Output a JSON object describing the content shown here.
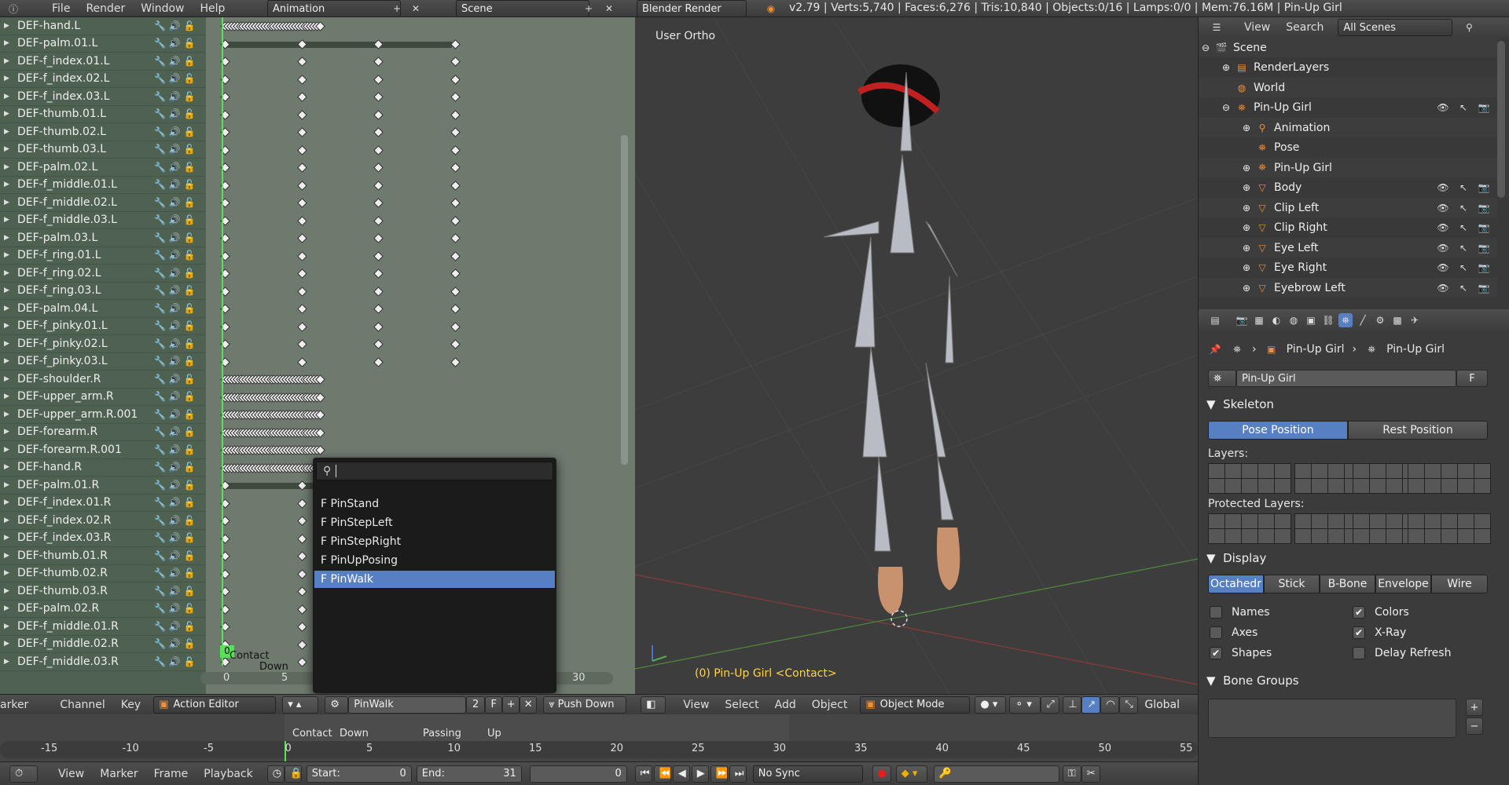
{
  "topbar": {
    "menus": [
      "File",
      "Render",
      "Window",
      "Help"
    ],
    "screen_layout": "Animation",
    "scene": "Scene",
    "engine": "Blender Render",
    "stats": "v2.79 | Verts:5,740 | Faces:6,276 | Tris:10,840 | Objects:0/16 | Lamps:0/0 | Mem:76.16M | Pin-Up Girl"
  },
  "dopesheet": {
    "channels": [
      "DEF-hand.L",
      "DEF-palm.01.L",
      "DEF-f_index.01.L",
      "DEF-f_index.02.L",
      "DEF-f_index.03.L",
      "DEF-thumb.01.L",
      "DEF-thumb.02.L",
      "DEF-thumb.03.L",
      "DEF-palm.02.L",
      "DEF-f_middle.01.L",
      "DEF-f_middle.02.L",
      "DEF-f_middle.03.L",
      "DEF-palm.03.L",
      "DEF-f_ring.01.L",
      "DEF-f_ring.02.L",
      "DEF-f_ring.03.L",
      "DEF-palm.04.L",
      "DEF-f_pinky.01.L",
      "DEF-f_pinky.02.L",
      "DEF-f_pinky.03.L",
      "DEF-shoulder.R",
      "DEF-upper_arm.R",
      "DEF-upper_arm.R.001",
      "DEF-forearm.R",
      "DEF-forearm.R.001",
      "DEF-hand.R",
      "DEF-palm.01.R",
      "DEF-f_index.01.R",
      "DEF-f_index.02.R",
      "DEF-f_index.03.R",
      "DEF-thumb.01.R",
      "DEF-thumb.02.R",
      "DEF-thumb.03.R",
      "DEF-palm.02.R",
      "DEF-f_middle.01.R",
      "DEF-f_middle.02.R",
      "DEF-f_middle.03.R"
    ],
    "channel_icons": "🔧 🔊 🔓",
    "markers": [
      "Contact",
      "Down",
      "Passing",
      "Up"
    ],
    "current_frame_badge": "0",
    "ruler": [
      "0",
      "5",
      "10",
      "15",
      "20",
      "25",
      "30"
    ]
  },
  "action_popup": {
    "search_icon": "search-icon",
    "items": [
      "F PinStand",
      "F PinStepLeft",
      "F PinStepRight",
      "F PinUpPosing",
      "F PinWalk"
    ],
    "selected": "F PinWalk"
  },
  "view3d": {
    "label": "User Ortho",
    "status": "(0) Pin-Up Girl <Contact>",
    "menus": [
      "View",
      "Select",
      "Add",
      "Object"
    ],
    "mode": "Object Mode",
    "orientation": "Global"
  },
  "dopesheet_header": {
    "menus": [
      "arker",
      "Channel",
      "Key"
    ],
    "editor": "Action Editor",
    "action": "PinWalk",
    "users": "2",
    "fake": "F",
    "push_down": "Push Down"
  },
  "timeline": {
    "ruler": [
      "-15",
      "-10",
      "-5",
      "0",
      "5",
      "10",
      "15",
      "20",
      "25",
      "30",
      "35",
      "40",
      "45",
      "50",
      "55"
    ],
    "markers": [
      "Contact",
      "Down",
      "Passing",
      "Up"
    ]
  },
  "timeline_header": {
    "menus": [
      "View",
      "Marker",
      "Frame",
      "Playback"
    ],
    "start_label": "Start:",
    "start": "0",
    "end_label": "End:",
    "end": "31",
    "current": "0",
    "sync": "No Sync"
  },
  "outliner": {
    "menus": [
      "View",
      "Search"
    ],
    "filter": "All Scenes",
    "items": [
      "Scene",
      "RenderLayers",
      "World",
      "Pin-Up Girl",
      "Animation",
      "Pose",
      "Pin-Up Girl",
      "Body",
      "Clip Left",
      "Clip Right",
      "Eye Left",
      "Eye Right",
      "Eyebrow Left"
    ]
  },
  "properties": {
    "breadcrumb": [
      "Pin-Up Girl",
      "Pin-Up Girl"
    ],
    "datablock": "Pin-Up Girl",
    "fake": "F",
    "skeleton_title": "Skeleton",
    "position_buttons": [
      "Pose Position",
      "Rest Position"
    ],
    "position_active": "Pose Position",
    "layers_label": "Layers:",
    "protected_label": "Protected Layers:",
    "display_title": "Display",
    "display_buttons": [
      "Octahedr",
      "Stick",
      "B-Bone",
      "Envelope",
      "Wire"
    ],
    "display_active": "Octahedr",
    "options": [
      {
        "label": "Names",
        "checked": false
      },
      {
        "label": "Colors",
        "checked": true
      },
      {
        "label": "Axes",
        "checked": false
      },
      {
        "label": "X-Ray",
        "checked": true
      },
      {
        "label": "Shapes",
        "checked": true
      },
      {
        "label": "Delay Refresh",
        "checked": false
      }
    ],
    "bone_groups_title": "Bone Groups"
  },
  "colors": {
    "accent": "#5680c2",
    "frame_line": "#58e058",
    "channel_bg": "#4f6150"
  }
}
